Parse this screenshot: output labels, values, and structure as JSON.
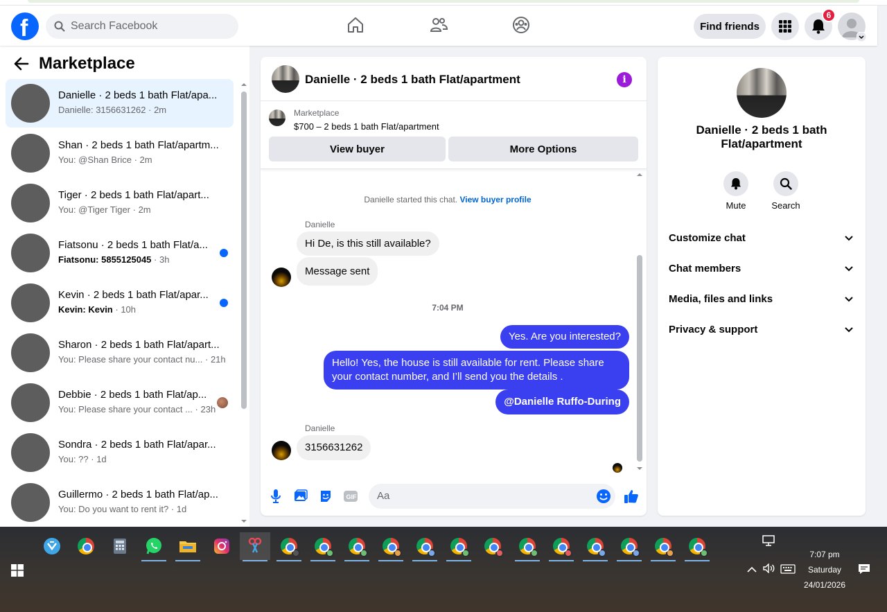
{
  "header": {
    "search_placeholder": "Search Facebook",
    "find_friends": "Find friends",
    "notification_count": "6"
  },
  "sidebar": {
    "title": "Marketplace",
    "conversations": [
      {
        "name": "Danielle · 2 beds 1 bath Flat/apa...",
        "preview": "Danielle: 3156631262",
        "time": "· 2m",
        "unread": false,
        "active": true
      },
      {
        "name": "Shan · 2 beds 1 bath Flat/apartm...",
        "preview": "You: @Shan Brice",
        "time": "· 2m",
        "unread": false
      },
      {
        "name": "Tiger · 2 beds 1 bath Flat/apart...",
        "preview": "You: @Tiger Tiger",
        "time": "· 2m",
        "unread": false
      },
      {
        "name": "Fiatsonu · 2 beds 1 bath Flat/a...",
        "preview": "Fiatsonu: 5855125045",
        "time": "· 3h",
        "unread": true
      },
      {
        "name": "Kevin · 2 beds 1 bath Flat/apar...",
        "preview": "Kevin: Kevin",
        "time": "· 10h",
        "unread": true
      },
      {
        "name": "Sharon · 2 beds 1 bath Flat/apart...",
        "preview": "You: Please share your contact nu...",
        "time": "· 21h",
        "unread": false
      },
      {
        "name": "Debbie · 2 beds 1 bath Flat/ap...",
        "preview": "You: Please share your contact ...",
        "time": "· 23h",
        "unread": false,
        "seen": true
      },
      {
        "name": "Sondra · 2 beds 1 bath Flat/apar...",
        "preview": "You: ??",
        "time": "· 1d",
        "unread": false
      },
      {
        "name": "Guillermo · 2 beds 1 bath Flat/ap...",
        "preview": "You: Do you want to rent it?",
        "time": "· 1d",
        "unread": false
      }
    ]
  },
  "chat": {
    "title": "Danielle · 2 beds 1 bath Flat/apartment",
    "listing_label": "Marketplace",
    "listing_title": "$700 – 2 beds 1 bath Flat/apartment",
    "view_buyer": "View buyer",
    "more_options": "More Options",
    "started_text": "Danielle started this chat.",
    "view_profile": "View buyer profile",
    "sender1": "Danielle",
    "msg1": "Hi De, is this still available?",
    "msg2": "Message sent",
    "timestamp": "7:04 PM",
    "out1": "Yes. Are you interested?",
    "out2": "Hello! Yes, the house is still available for rent. Please share your contact number, and I’ll send you the details .",
    "out3": "@Danielle Ruffo-During",
    "sender2": "Danielle",
    "msg3": "3156631262",
    "input_placeholder": "Aa"
  },
  "details": {
    "title": "Danielle · 2 beds 1 bath Flat/apartment",
    "mute": "Mute",
    "search": "Search",
    "rows": [
      "Customize chat",
      "Chat members",
      "Media, files and links",
      "Privacy & support"
    ]
  },
  "taskbar": {
    "time": "7:07 pm",
    "day": "Saturday",
    "date": "24/01/2026"
  },
  "colors": {
    "brand": "#0866ff",
    "outgoing_bubble": "#3a3ff0",
    "active_row": "#e7f3ff",
    "badge": "#e41e3f"
  }
}
